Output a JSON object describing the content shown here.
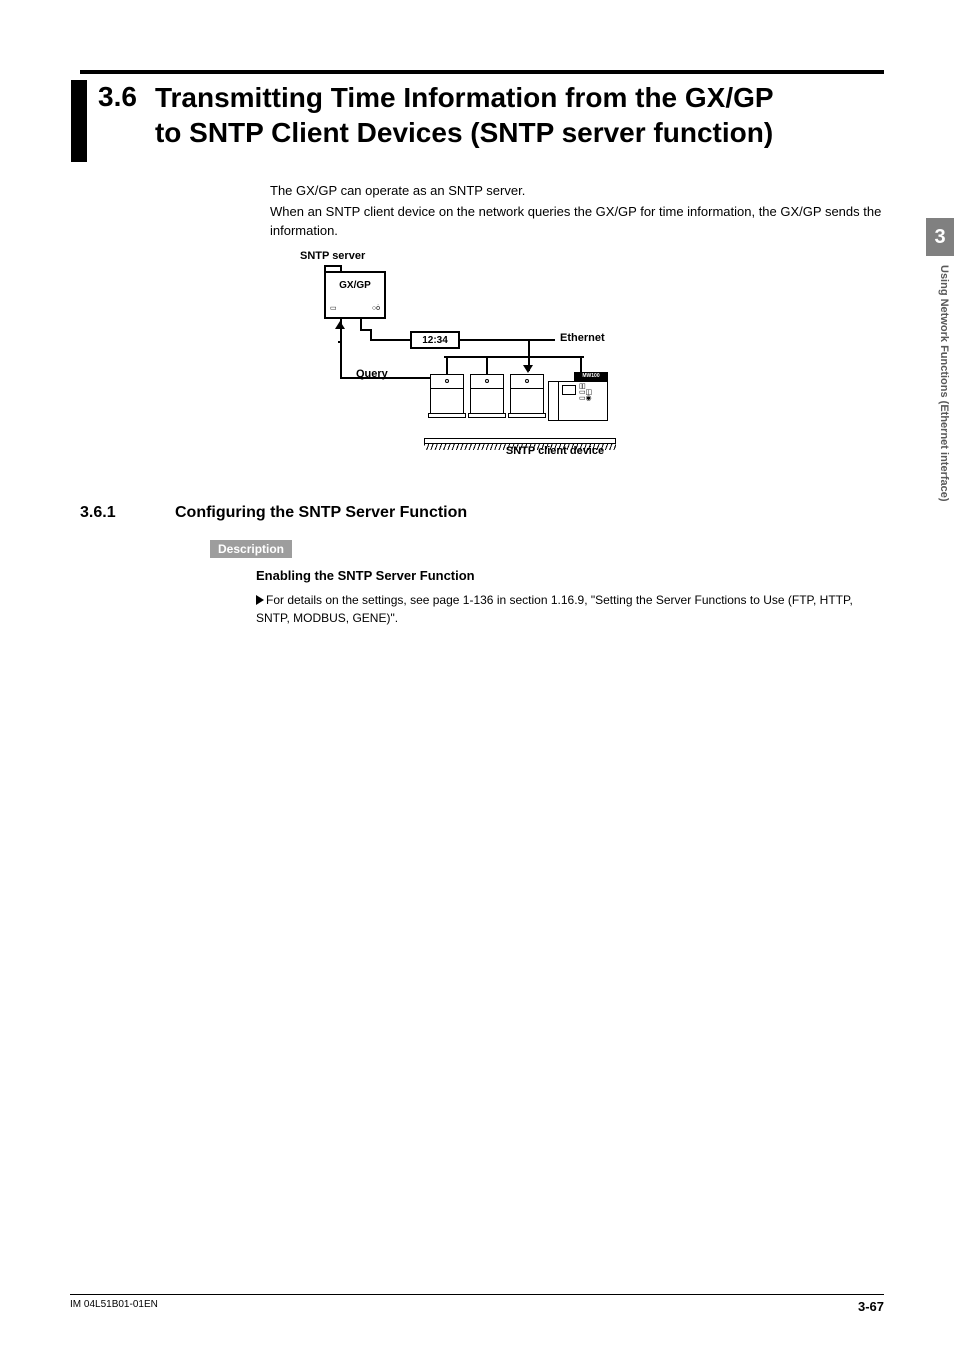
{
  "section": {
    "number": "3.6",
    "title_line1": "Transmitting Time Information from the GX/GP",
    "title_line2": "to SNTP Client Devices (SNTP server function)"
  },
  "intro": {
    "line1": "The GX/GP can operate as an SNTP server.",
    "line2": "When an SNTP client device on the network queries the GX/GP for time information, the GX/GP sends the information."
  },
  "diagram": {
    "sntp_server_label": "SNTP server",
    "device_label": "GX/GP",
    "time_label": "12:34",
    "ethernet_label": "Ethernet",
    "query_label": "Query",
    "client_label": "SNTP client device",
    "mw_label": "MW100"
  },
  "subsection": {
    "number": "3.6.1",
    "title": "Configuring the SNTP Server Function"
  },
  "description": {
    "tag": "Description",
    "subheading": "Enabling the SNTP Server Function",
    "text": "For details on the settings, see page 1-136 in section 1.16.9, \"Setting the Server Functions to Use (FTP, HTTP, SNTP, MODBUS, GENE)\"."
  },
  "side": {
    "chapter": "3",
    "label": "Using Network Functions (Ethernet interface)"
  },
  "footer": {
    "doc_id": "IM 04L51B01-01EN",
    "page": "3-67"
  }
}
